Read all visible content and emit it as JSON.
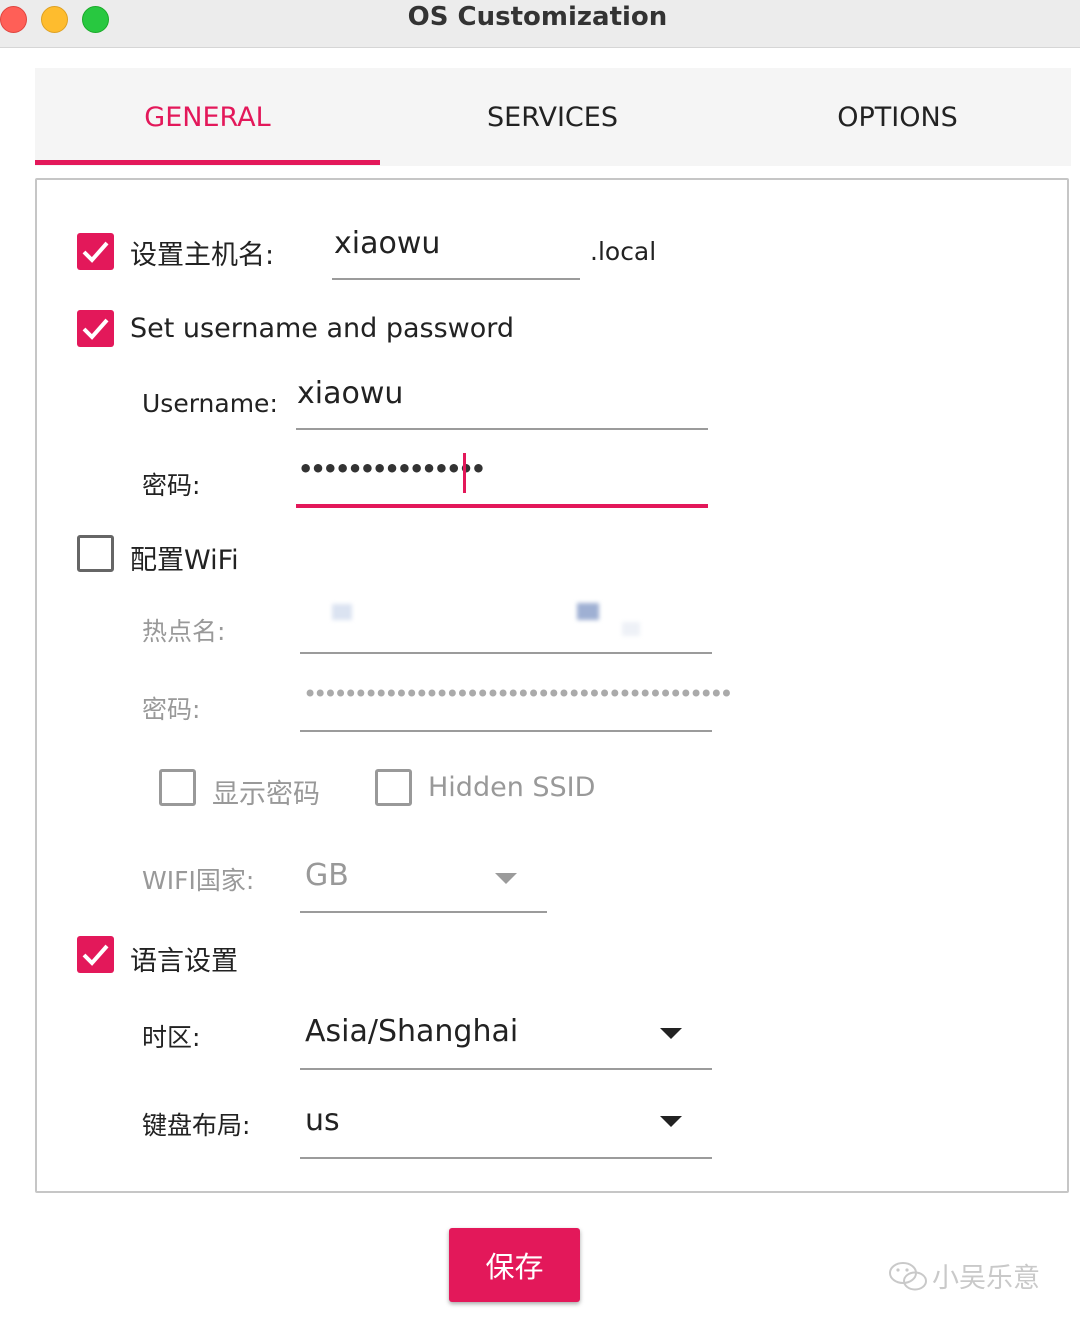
{
  "window": {
    "title": "OS Customization"
  },
  "tabs": [
    {
      "label": "GENERAL",
      "active": true
    },
    {
      "label": "SERVICES",
      "active": false
    },
    {
      "label": "OPTIONS",
      "active": false
    }
  ],
  "colors": {
    "accent": "#e3185a",
    "disabled_text": "#999999",
    "underline": "#9b9b9b"
  },
  "hostname": {
    "label": "设置主机名:",
    "checked": true,
    "value": "xiaowu",
    "suffix": ".local"
  },
  "user": {
    "label": "Set username and password",
    "checked": true,
    "username_label": "Username:",
    "username_value": "xiaowu",
    "password_label": "密码:",
    "password_mask": "•••••••••••••••"
  },
  "wifi": {
    "label": "配置WiFi",
    "checked": false,
    "ssid_label": "热点名:",
    "password_label": "密码:",
    "password_mask": "••••••••••••••••••••••••••••••••••••••••••",
    "show_password_label": "显示密码",
    "show_password_checked": false,
    "hidden_ssid_label": "Hidden SSID",
    "hidden_ssid_checked": false,
    "country_label": "WIFI国家:",
    "country_value": "GB"
  },
  "locale": {
    "label": "语言设置",
    "checked": true,
    "timezone_label": "时区:",
    "timezone_value": "Asia/Shanghai",
    "keyboard_label": "键盘布局:",
    "keyboard_value": "us"
  },
  "actions": {
    "save_label": "保存"
  },
  "watermark": {
    "text": "小吴乐意",
    "icon": "wechat-icon"
  }
}
